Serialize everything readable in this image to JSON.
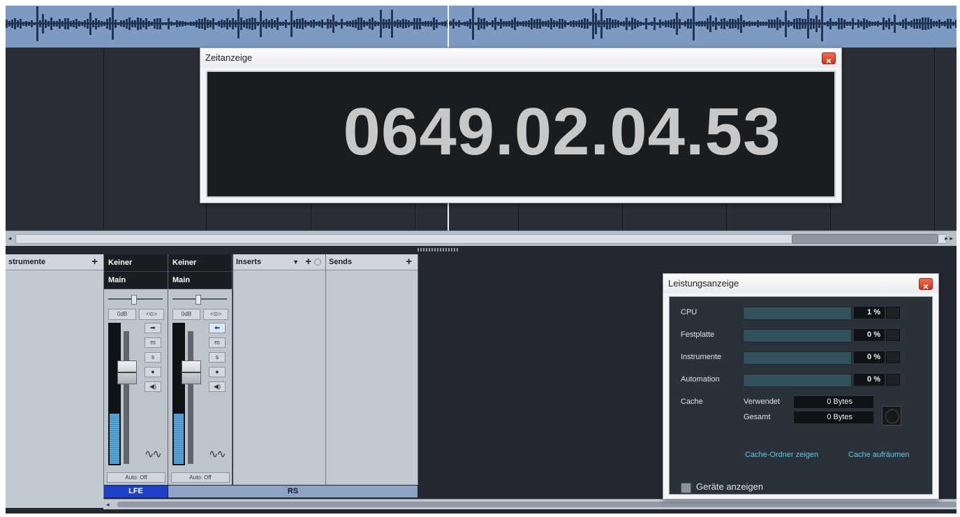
{
  "zeitanzeige": {
    "title": "Zeitanzeige",
    "time": "0649.02.04.53"
  },
  "mixer": {
    "instrumente_label": "strumente",
    "inserts_label": "Inserts",
    "sends_label": "Sends",
    "channels": [
      {
        "input": "Keiner",
        "output": "Main",
        "volume": "0dB",
        "link": "<⊙>",
        "auto": "Auto: Off",
        "name": "LFE",
        "name_color": "#1b3fc9"
      },
      {
        "input": "Keiner",
        "output": "Main",
        "volume": "0dB",
        "link": "<⊙>",
        "auto": "Auto: Off",
        "name": "RS",
        "name_color": "#8ea3c6"
      }
    ]
  },
  "leistung": {
    "title": "Leistungsanzeige",
    "rows": [
      {
        "label": "CPU",
        "value": "1 %"
      },
      {
        "label": "Festplatte",
        "value": "0 %"
      },
      {
        "label": "Instrumente",
        "value": "0 %"
      },
      {
        "label": "Automation",
        "value": "0 %"
      }
    ],
    "cache": {
      "label": "Cache",
      "used_label": "Verwendet",
      "used_value": "0 Bytes",
      "total_label": "Gesamt",
      "total_value": "0 Bytes",
      "show_folder": "Cache-Ordner zeigen",
      "clear": "Cache aufräumen"
    },
    "show_devices": "Geräte anzeigen"
  }
}
